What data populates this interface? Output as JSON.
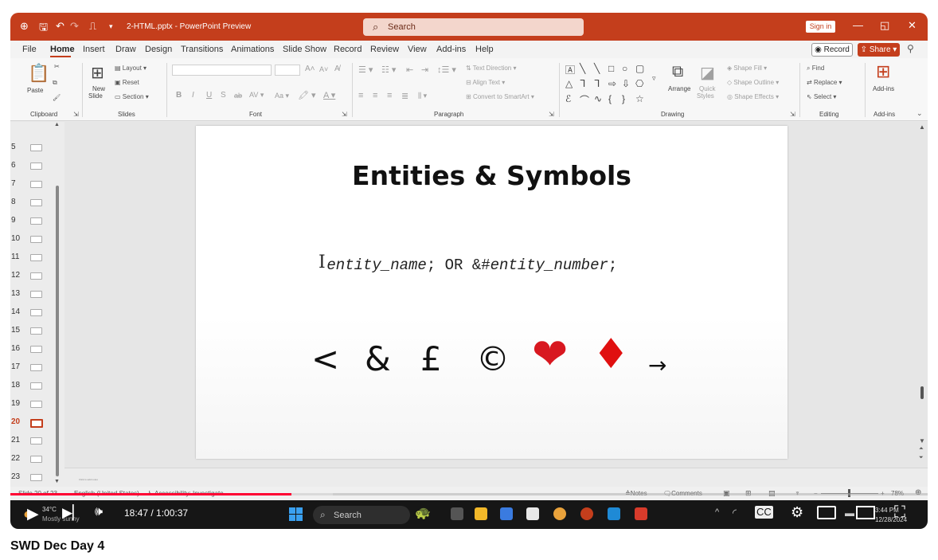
{
  "window": {
    "doc_title": "2-HTML.pptx - PowerPoint Preview",
    "search_placeholder": "Search",
    "sign_in": "Sign in",
    "minimize": "—",
    "restore": "◱",
    "close": "✕"
  },
  "tabs": [
    "File",
    "Home",
    "Insert",
    "Draw",
    "Design",
    "Transitions",
    "Animations",
    "Slide Show",
    "Record",
    "Review",
    "View",
    "Add-ins",
    "Help"
  ],
  "active_tab": "Home",
  "record_label": "Record",
  "share_label": "Share",
  "ribbon": {
    "clipboard": {
      "paste": "Paste",
      "label": "Clipboard"
    },
    "slides": {
      "new_slide_1": "New",
      "new_slide_2": "Slide",
      "layout": "Layout",
      "reset": "Reset",
      "section": "Section",
      "label": "Slides"
    },
    "font": {
      "label": "Font",
      "bold": "B",
      "italic": "I",
      "underline": "U",
      "strike": "S",
      "abc": "ab",
      "spacing": "AV",
      "case": "Aa",
      "grow": "A",
      "shrink": "A"
    },
    "paragraph": {
      "text_direction": "Text Direction",
      "align_text": "Align Text",
      "convert_smartart": "Convert to SmartArt",
      "label": "Paragraph"
    },
    "drawing": {
      "arrange": "Arrange",
      "quick_1": "Quick",
      "quick_2": "Styles",
      "shape_fill": "Shape Fill",
      "shape_outline": "Shape Outline",
      "shape_effects": "Shape Effects",
      "label": "Drawing"
    },
    "editing": {
      "find": "Find",
      "replace": "Replace",
      "select": "Select",
      "label": "Editing"
    },
    "addins": {
      "addins": "Add-ins",
      "label": "Add-ins"
    }
  },
  "thumbnails": {
    "numbers": [
      "5",
      "6",
      "7",
      "8",
      "9",
      "10",
      "11",
      "12",
      "13",
      "14",
      "15",
      "16",
      "17",
      "18",
      "19",
      "20",
      "21",
      "22",
      "23"
    ],
    "active": "20"
  },
  "slide": {
    "title": "Entities & Symbols",
    "syntax_entity_name": "entity_name",
    "syntax_semicolon_1": ";",
    "syntax_or": " OR &#",
    "syntax_entity_number": "entity_number",
    "syntax_semicolon_2": ";",
    "symbols": [
      "<",
      "&",
      "£",
      "©",
      "❤",
      "♦",
      "→"
    ]
  },
  "notes_placeholder": "Click to add notes",
  "status": {
    "slide_of": "Slide 20 of 23",
    "language": "English (United States)",
    "accessibility": "Accessibility: Investigate",
    "notes": "Notes",
    "comments": "Comments",
    "zoom": "78%"
  },
  "video": {
    "played_fraction": 0.3067,
    "current_time": "18:47",
    "total_time": "1:00:37",
    "time_text": "18:47 / 1:00:37",
    "title": "SWD Dec Day 4"
  },
  "taskbar": {
    "weather_temp": "34°C",
    "weather_text": "Mostly sunny",
    "search": "Search",
    "clock_time": "3:44 PM",
    "clock_date": "12/28/2024"
  },
  "colors": {
    "ppt_accent": "#c43e1c",
    "youtube_red": "#ff0033",
    "heart": "#d81820",
    "diamond": "#e01010"
  }
}
